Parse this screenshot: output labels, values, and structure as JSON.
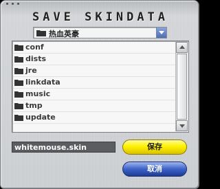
{
  "window": {
    "title": "SAVE SKINDATA"
  },
  "path": {
    "current": "热血英豪"
  },
  "files": {
    "items": [
      {
        "label": "conf"
      },
      {
        "label": "dists"
      },
      {
        "label": "jre"
      },
      {
        "label": "linkdata"
      },
      {
        "label": "music"
      },
      {
        "label": "tmp"
      },
      {
        "label": "update"
      }
    ]
  },
  "filename": {
    "value": "whitemouse.skin"
  },
  "buttons": {
    "save_label": "保存",
    "cancel_label": "取消"
  },
  "colors": {
    "save": "#fff200",
    "cancel": "#3d62c8",
    "folder": "#333333"
  },
  "icons": {
    "folder": "folder-icon",
    "dropdown": "chevron-down-icon"
  }
}
